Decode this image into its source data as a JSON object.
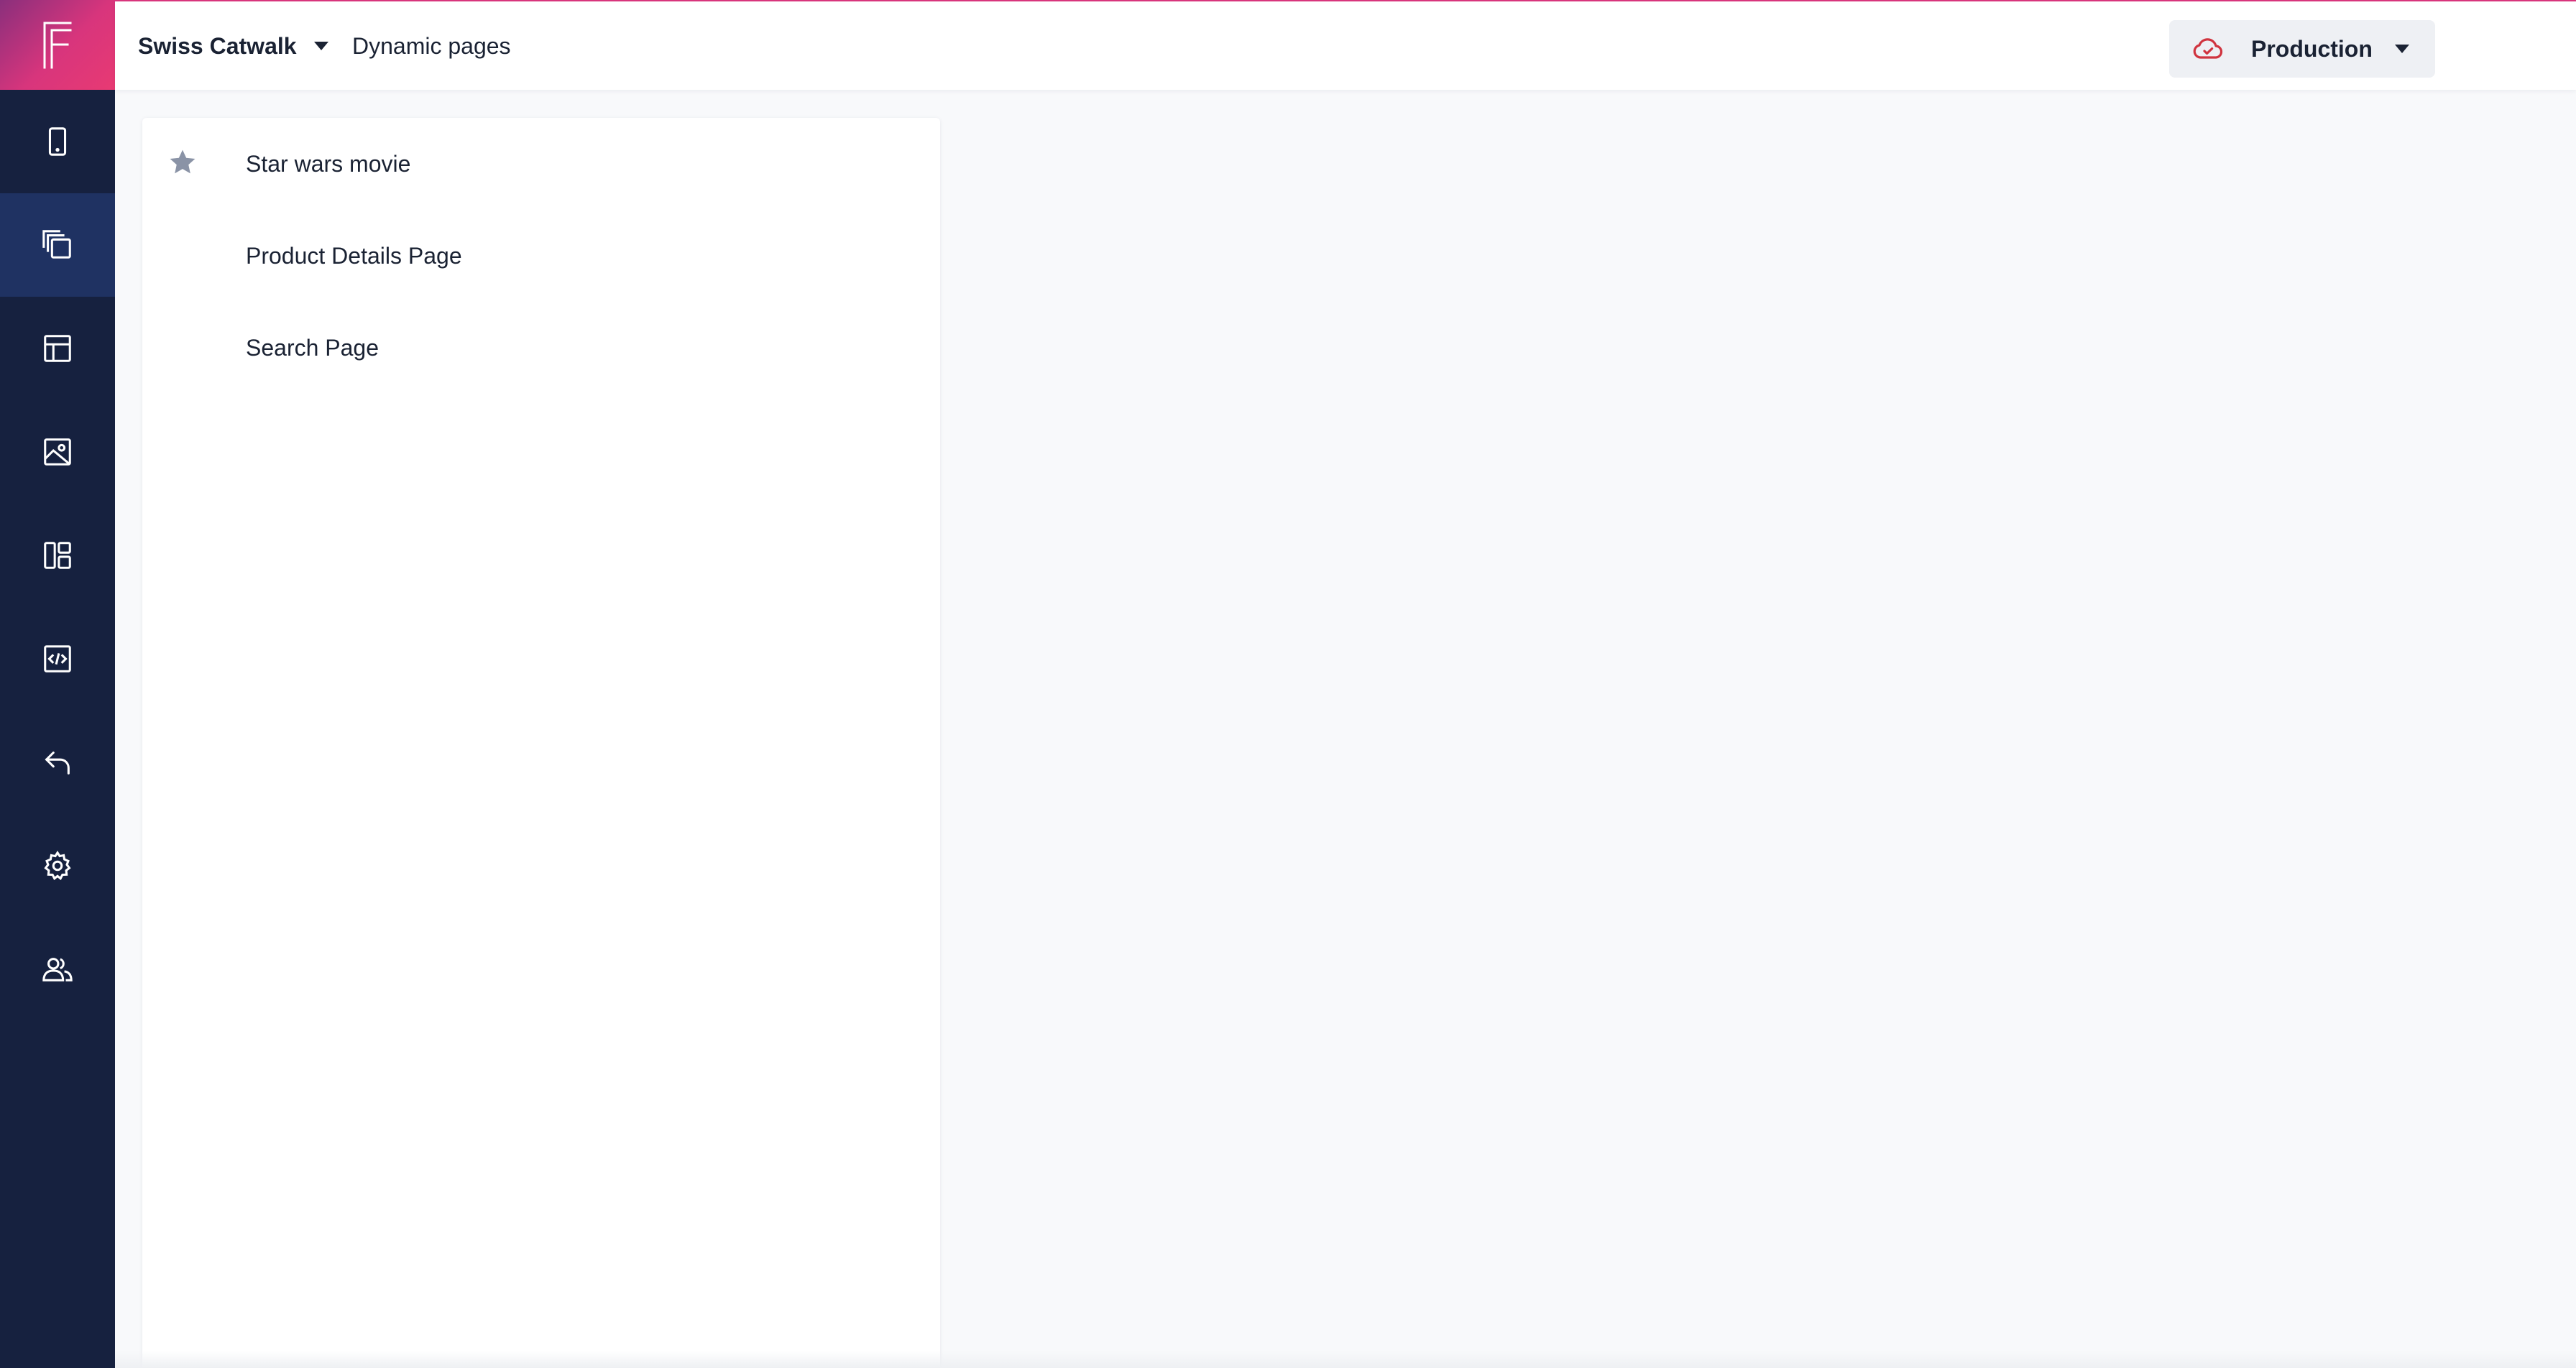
{
  "header": {
    "project_name": "Swiss Catwalk",
    "breadcrumb": "Dynamic pages",
    "environment_label": "Production"
  },
  "sidebar": {
    "items": [
      {
        "icon": "mobile-device-icon",
        "active": false
      },
      {
        "icon": "dynamic-pages-icon",
        "active": true
      },
      {
        "icon": "page-layout-icon",
        "active": false
      },
      {
        "icon": "media-image-icon",
        "active": false
      },
      {
        "icon": "components-icon",
        "active": false
      },
      {
        "icon": "code-developer-icon",
        "active": false
      },
      {
        "icon": "undo-reply-icon",
        "active": false
      },
      {
        "icon": "gear-icon",
        "active": false
      },
      {
        "icon": "users-icon",
        "active": false
      }
    ]
  },
  "pages": [
    {
      "label": "Star wars movie",
      "starred": true
    },
    {
      "label": "Product Details Page",
      "starred": false
    },
    {
      "label": "Search Page",
      "starred": false
    }
  ],
  "colors": {
    "sidebar_bg": "#16213f",
    "sidebar_active": "#1f3262",
    "brand_pink": "#d8357c",
    "env_icon": "#d0343f",
    "star": "#8a93a6"
  }
}
